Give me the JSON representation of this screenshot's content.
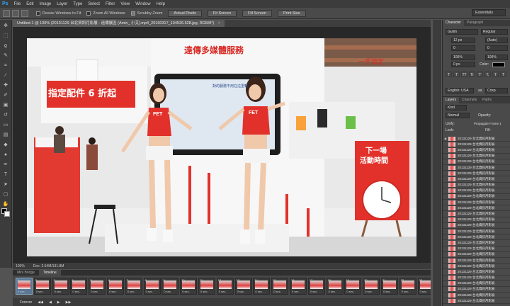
{
  "menubar": {
    "logo": "Ps",
    "items": [
      "File",
      "Edit",
      "Image",
      "Layer",
      "Type",
      "Select",
      "Filter",
      "View",
      "Window",
      "Help"
    ]
  },
  "options_bar": {
    "checkboxes": [
      "Resize Windows to Fit",
      "Zoom All Windows",
      "Scrubby Zoom"
    ],
    "buttons": [
      "Actual Pixels",
      "Fit Screen",
      "Fill Screen",
      "Print Size"
    ],
    "workspace": "Essentials"
  },
  "document_tab": {
    "title": "Untitled-1 @ 100% (20131129 台北資訊月影展 - 遠傳展區 (Amin_ 小艾).mp4_20160317_104526.528.jpg, RGB/8*)",
    "close": "×"
  },
  "status_bar": {
    "zoom": "100%",
    "doc": "Doc: 2.64M/131.8M"
  },
  "timeline": {
    "tabs": [
      "Mini Bridge",
      "Timeline"
    ],
    "frame_count": 23,
    "frame_duration": "0 sec.",
    "controls": [
      "Forever",
      "◀◀",
      "◀",
      "▶",
      "▶▶"
    ]
  },
  "character_panel": {
    "tabs": [
      "Character",
      "Paragraph"
    ],
    "font_family": "Gulim",
    "font_style": "Regular",
    "font_size": "12 px",
    "leading": "(Auto)",
    "kerning": "0",
    "tracking": "0",
    "vscale": "100%",
    "hscale": "100%",
    "baseline": "0 px",
    "color_label": "Color:",
    "language": "English: USA",
    "aa_mode": "Crisp",
    "aa_label": "aa",
    "style_icons": [
      "T",
      "T",
      "TT",
      "Tr",
      "T'",
      "T,",
      "T",
      "T"
    ]
  },
  "layers_panel": {
    "tabs": [
      "Layers",
      "Channels",
      "Paths"
    ],
    "filter_label": "Kind",
    "blend_mode": "Normal",
    "opacity_label": "Opacity:",
    "unify_label": "Unify:",
    "lock_label": "Lock:",
    "propagate_label": "Propagate Frame 1",
    "fill_label": "Fill:",
    "layer_name": "20131129 台北資訊月影展",
    "layer_rows": 29
  },
  "canvas_text": {
    "banner_top": "遠傳多媒體服務",
    "banner_right": "一手搞定",
    "sign_left": "指定配件 6 折起",
    "sign_right_line1": "下一場",
    "sign_right_line2": "活動時間",
    "shirt_logo": "FET",
    "screen_text": "對的服務不用在這里輸..."
  },
  "colors": {
    "accent_red": "#e2312b",
    "ps_blue": "#31a8ff",
    "panel_bg": "#4a4a4a",
    "app_bg": "#535353"
  }
}
